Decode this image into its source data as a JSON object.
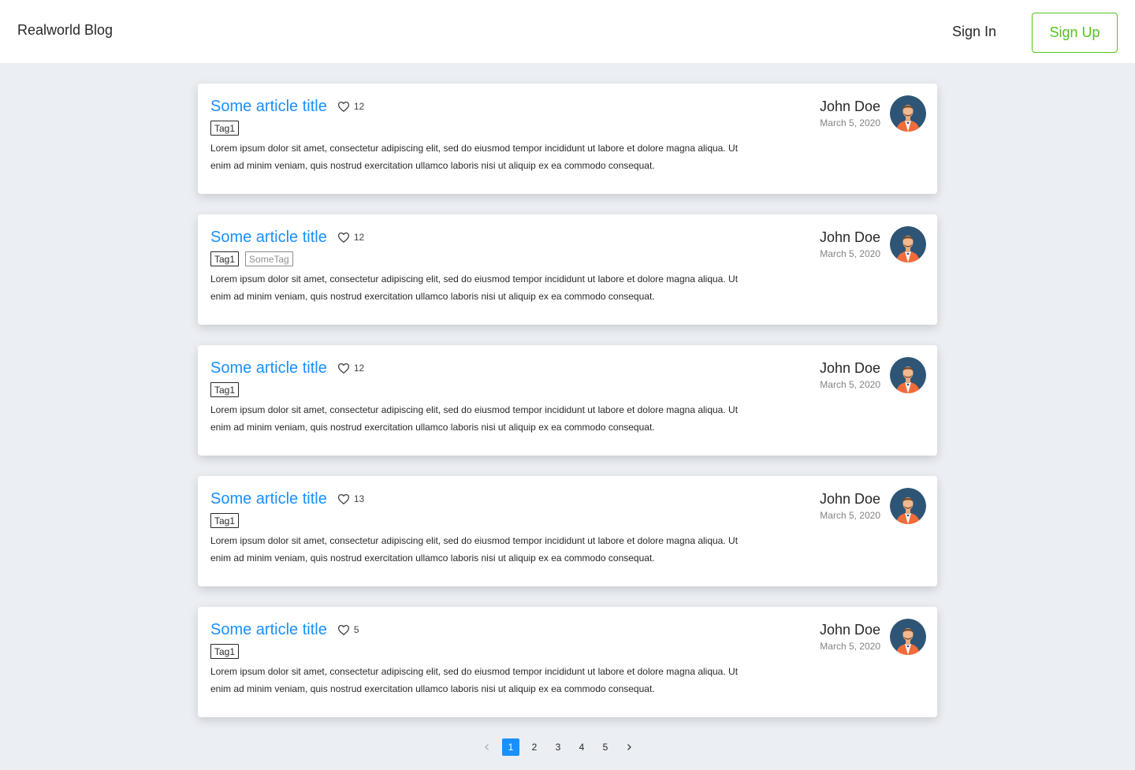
{
  "header": {
    "logo": "Realworld Blog",
    "sign_in": "Sign In",
    "sign_up": "Sign Up"
  },
  "colors": {
    "accent": "#1890ff",
    "signup": "#52c41a",
    "background": "#ebeef3"
  },
  "articles": [
    {
      "title": "Some article title",
      "likes": "12",
      "tags": [
        "Tag1"
      ],
      "text": "Lorem ipsum dolor sit amet, consectetur adipiscing elit, sed do eiusmod tempor incididunt ut labore et dolore magna aliqua. Ut enim ad minim veniam, quis nostrud exercitation ullamco laboris  nisi ut aliquip ex ea commodo consequat.",
      "author": "John Doe",
      "date": "March 5, 2020"
    },
    {
      "title": "Some article title",
      "likes": "12",
      "tags": [
        "Tag1",
        "SomeTag"
      ],
      "text": "Lorem ipsum dolor sit amet, consectetur adipiscing elit, sed do eiusmod tempor incididunt ut labore et dolore magna aliqua. Ut enim ad minim veniam, quis nostrud exercitation ullamco laboris  nisi ut aliquip ex ea commodo consequat.",
      "author": "John Doe",
      "date": "March 5, 2020"
    },
    {
      "title": "Some article title",
      "likes": "12",
      "tags": [
        "Tag1"
      ],
      "text": "Lorem ipsum dolor sit amet, consectetur adipiscing elit, sed do eiusmod tempor incididunt ut labore et dolore magna aliqua. Ut enim ad minim veniam, quis nostrud exercitation ullamco laboris  nisi ut aliquip ex ea commodo consequat.",
      "author": "John Doe",
      "date": "March 5, 2020"
    },
    {
      "title": "Some article title",
      "likes": "13",
      "tags": [
        "Tag1"
      ],
      "text": "Lorem ipsum dolor sit amet, consectetur adipiscing elit, sed do eiusmod tempor incididunt ut labore et dolore magna aliqua. Ut enim ad minim veniam, quis nostrud exercitation ullamco laboris  nisi ut aliquip ex ea commodo consequat.",
      "author": "John Doe",
      "date": "March 5, 2020"
    },
    {
      "title": "Some article title",
      "likes": "5",
      "tags": [
        "Tag1"
      ],
      "text": "Lorem ipsum dolor sit amet, consectetur adipiscing elit, sed do eiusmod tempor incididunt ut labore et dolore magna aliqua. Ut enim ad minim veniam, quis nostrud exercitation ullamco laboris  nisi ut aliquip ex ea commodo consequat.",
      "author": "John Doe",
      "date": "March 5, 2020"
    }
  ],
  "pagination": {
    "pages": [
      "1",
      "2",
      "3",
      "4",
      "5"
    ],
    "current": "1",
    "prev_icon": "chevron-left-icon",
    "next_icon": "chevron-right-icon"
  }
}
